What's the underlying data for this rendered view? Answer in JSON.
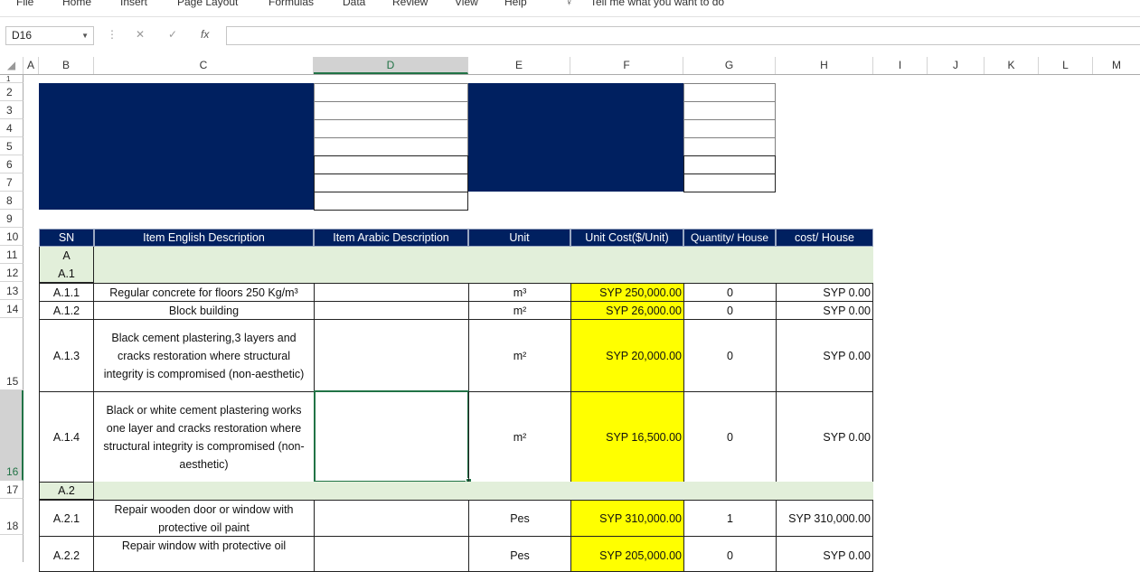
{
  "ribbon": {
    "tabs": [
      "File",
      "Home",
      "Insert",
      "Page Layout",
      "Formulas",
      "Data",
      "Review",
      "View",
      "Help"
    ],
    "tell_me": "Tell me what you want to do"
  },
  "formula_bar": {
    "name_box": "D16",
    "fx_label": "fx",
    "formula": ""
  },
  "columns": [
    "A",
    "B",
    "C",
    "D",
    "E",
    "F",
    "G",
    "H",
    "I",
    "J",
    "K",
    "L",
    "M"
  ],
  "rows": [
    "1",
    "2",
    "3",
    "4",
    "5",
    "6",
    "7",
    "8",
    "9",
    "10",
    "11",
    "12",
    "13",
    "14",
    "15",
    "16",
    "17",
    "18"
  ],
  "table": {
    "headers": [
      "SN",
      "Item English Description",
      "Item Arabic Description",
      "Unit",
      "Unit Cost($/Unit)",
      "Quantity/ House",
      "cost/ House"
    ],
    "section_a": "A",
    "section_a1": "A.1",
    "section_a2": "A.2",
    "items": [
      {
        "sn": "A.1.1",
        "desc": "Regular concrete for floors 250 Kg/m³",
        "arabic": "",
        "unit": "m³",
        "cost": "SYP 250,000.00",
        "qty": "0",
        "total": "SYP 0.00"
      },
      {
        "sn": "A.1.2",
        "desc": "Block building",
        "arabic": "",
        "unit": "m²",
        "cost": "SYP 26,000.00",
        "qty": "0",
        "total": "SYP 0.00"
      },
      {
        "sn": "A.1.3",
        "desc": "Black cement plastering,3 layers and cracks restoration where structural integrity is compromised (non-aesthetic)",
        "arabic": "",
        "unit": "m²",
        "cost": "SYP 20,000.00",
        "qty": "0",
        "total": "SYP 0.00"
      },
      {
        "sn": "A.1.4",
        "desc": "Black or white cement plastering works one layer and cracks restoration where structural integrity is compromised (non-aesthetic)",
        "arabic": "",
        "unit": "m²",
        "cost": "SYP 16,500.00",
        "qty": "0",
        "total": "SYP 0.00"
      },
      {
        "sn": "A.2.1",
        "desc": "Repair wooden door or window with protective oil paint",
        "arabic": "",
        "unit": "Pes",
        "cost": "SYP 310,000.00",
        "qty": "1",
        "total": "SYP 310,000.00"
      },
      {
        "sn": "A.2.2",
        "desc": "Repair window with protective oil",
        "arabic": "",
        "unit": "Pes",
        "cost": "SYP 205,000.00",
        "qty": "0",
        "total": "SYP 0.00"
      }
    ]
  },
  "colors": {
    "navy": "#002060",
    "green_band": "#e2efda",
    "yellow": "#ffff00",
    "excel_green": "#217346"
  }
}
